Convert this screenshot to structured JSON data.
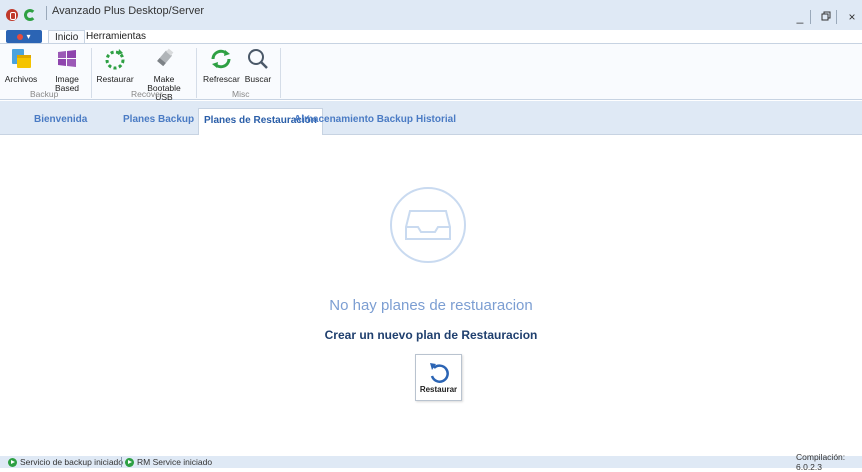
{
  "window": {
    "title": "Avanzado Plus Desktop/Server",
    "minimize": "_",
    "maximize": "▫",
    "close": "×"
  },
  "ribbon_tabs": {
    "app_menu": "▾",
    "home": "Inicio",
    "tools": "Herramientas"
  },
  "ribbon": {
    "groups": {
      "backup": "Backup",
      "recover": "Recover",
      "misc": "Misc"
    },
    "buttons": {
      "archivos": "Archivos",
      "image_based_1": "Image",
      "image_based_2": "Based",
      "restaurar": "Restaurar",
      "make_usb_1": "Make",
      "make_usb_2": "Bootable USB",
      "refrescar": "Refrescar",
      "buscar": "Buscar"
    }
  },
  "main_tabs": {
    "welcome": "Bienvenida",
    "backup_plans": "Planes Backup",
    "restore_plans": "Planes de Restauración",
    "backup_storage": "Almacenamiento Backup",
    "history": "Historial"
  },
  "content": {
    "empty_title": "No hay planes de restuaracion",
    "create_link": "Crear un nuevo plan de Restauracion",
    "restore_button": "Restaurar"
  },
  "statusbar": {
    "backup_service": "Servicio de backup iniciado",
    "rm_service": "RM Service iniciado",
    "build": "Compilación: 6.0.2.3"
  },
  "colors": {
    "accent": "#2b64b4",
    "tab_text": "#4a7bc4",
    "status_ok": "#2ea043"
  }
}
